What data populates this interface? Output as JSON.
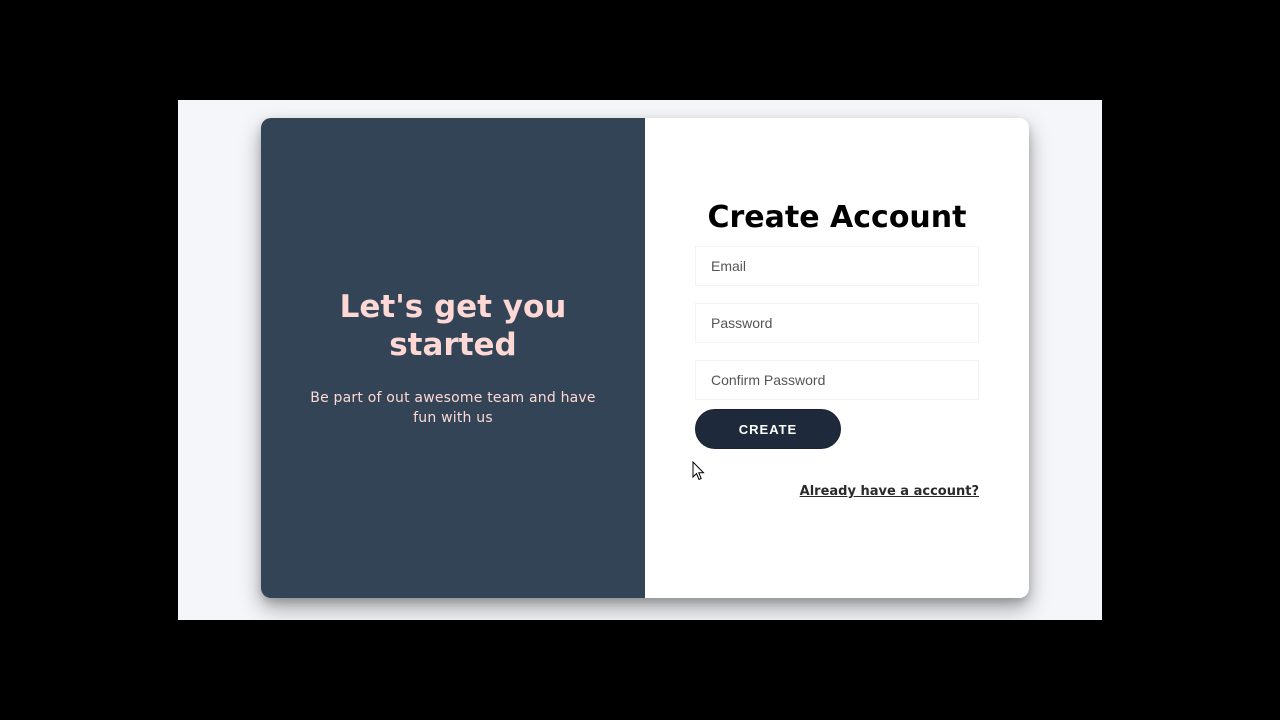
{
  "left_panel": {
    "title": "Let's get you started",
    "text": "Be part of out awesome team and have fun with us",
    "background": "#334456",
    "text_color": "#fdd8d4"
  },
  "form": {
    "title": "Create Account",
    "email_placeholder": "Email",
    "email_value": "",
    "password_placeholder": "Password",
    "password_value": "",
    "confirm_placeholder": "Confirm Password",
    "confirm_value": "",
    "create_label": "CREATE",
    "login_link": "Already have a account?",
    "button_color": "#1e2a3b"
  },
  "icons": {
    "cursor": "mouse-pointer-icon"
  }
}
